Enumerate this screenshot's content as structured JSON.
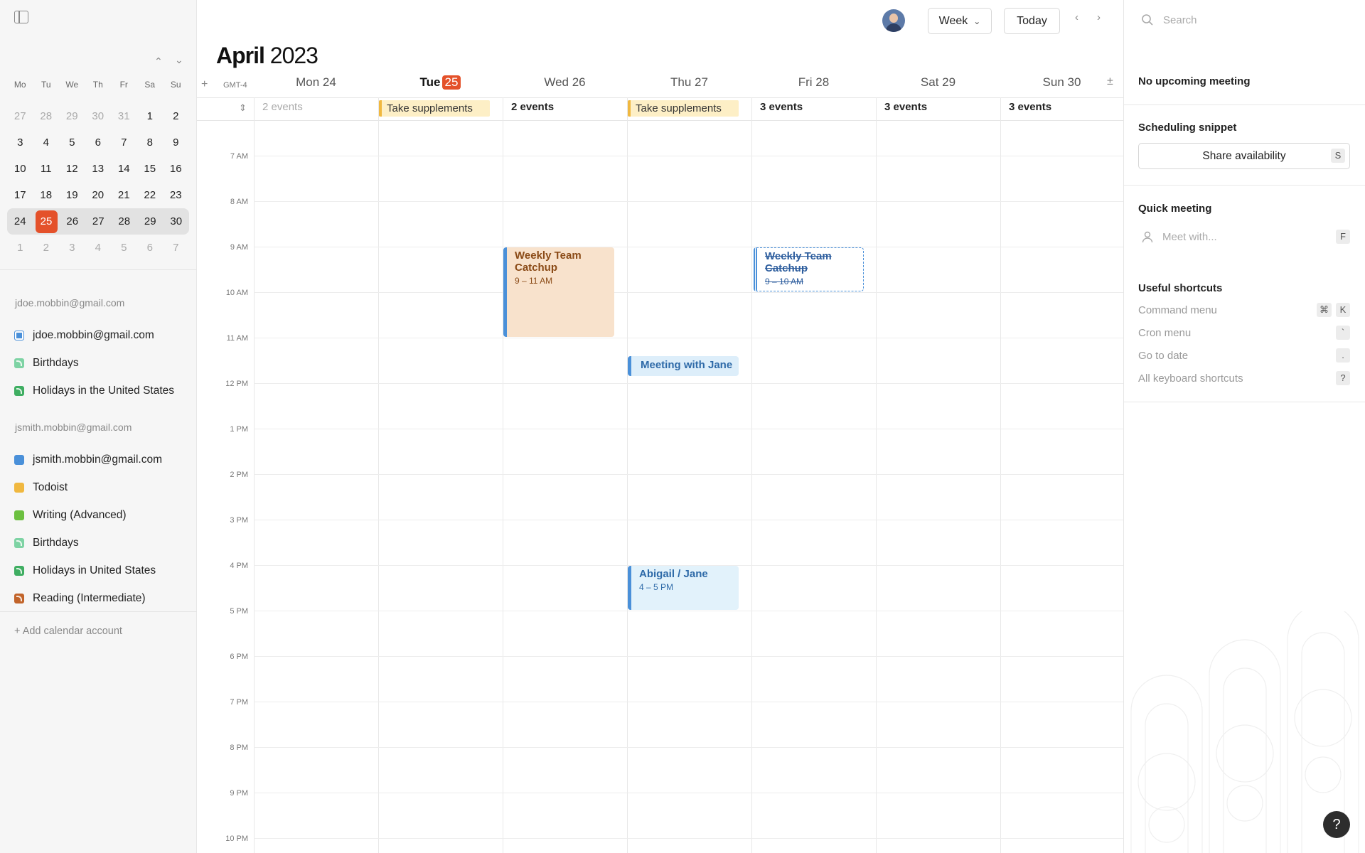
{
  "sidebar": {
    "mini_calendar": {
      "weekday_headers": [
        "Mo",
        "Tu",
        "We",
        "Th",
        "Fr",
        "Sa",
        "Su"
      ],
      "weeks": [
        [
          "27",
          "28",
          "29",
          "30",
          "31",
          "1",
          "2"
        ],
        [
          "3",
          "4",
          "5",
          "6",
          "7",
          "8",
          "9"
        ],
        [
          "10",
          "11",
          "12",
          "13",
          "14",
          "15",
          "16"
        ],
        [
          "17",
          "18",
          "19",
          "20",
          "21",
          "22",
          "23"
        ],
        [
          "24",
          "25",
          "26",
          "27",
          "28",
          "29",
          "30"
        ],
        [
          "1",
          "2",
          "3",
          "4",
          "5",
          "6",
          "7"
        ]
      ],
      "today": "25"
    },
    "accounts": [
      {
        "email": "jdoe.mobbin@gmail.com",
        "calendars": [
          {
            "name": "jdoe.mobbin@gmail.com",
            "color": "#4a90d9",
            "type": "checked"
          },
          {
            "name": "Birthdays",
            "color": "#7ed3a4",
            "type": "rss"
          },
          {
            "name": "Holidays in the United States",
            "color": "#3fae62",
            "type": "rss"
          }
        ]
      },
      {
        "email": "jsmith.mobbin@gmail.com",
        "calendars": [
          {
            "name": "jsmith.mobbin@gmail.com",
            "color": "#4a90d9",
            "type": "plain"
          },
          {
            "name": "Todoist",
            "color": "#f0b840",
            "type": "plain"
          },
          {
            "name": "Writing (Advanced)",
            "color": "#6cc040",
            "type": "plain"
          },
          {
            "name": "Birthdays",
            "color": "#7ed3a4",
            "type": "rss"
          },
          {
            "name": "Holidays in United States",
            "color": "#3fae62",
            "type": "rss"
          },
          {
            "name": "Reading (Intermediate)",
            "color": "#c2642a",
            "type": "rss"
          }
        ]
      }
    ],
    "add_account_label": "+ Add calendar account"
  },
  "toolbar": {
    "view_label": "Week",
    "today_label": "Today"
  },
  "calendar": {
    "month": "April",
    "year": "2023",
    "timezone": "GMT-4",
    "days": [
      {
        "label": "Mon 24",
        "allday": "2 events",
        "allday_dim": true
      },
      {
        "label": "Tue",
        "badge": "25",
        "today": true,
        "allday_event": "Take supplements"
      },
      {
        "label": "Wed 26",
        "allday": "2 events"
      },
      {
        "label": "Thu 27",
        "allday_event": "Take supplements"
      },
      {
        "label": "Fri 28",
        "allday": "3 events"
      },
      {
        "label": "Sat 29",
        "allday": "3 events"
      },
      {
        "label": "Sun 30",
        "allday": "3 events"
      }
    ],
    "hours": [
      "7 AM",
      "8 AM",
      "9 AM",
      "10 AM",
      "11 AM",
      "12 PM",
      "1 PM",
      "2 PM",
      "3 PM",
      "4 PM",
      "5 PM",
      "6 PM",
      "7 PM",
      "8 PM",
      "9 PM",
      "10 PM"
    ],
    "events": [
      {
        "title": "Weekly Team Catchup",
        "time": "9 – 11 AM",
        "day": 2
      },
      {
        "title": "Weekly Team Catchup",
        "time": "9 – 10 AM",
        "day": 4,
        "cancelled": true
      },
      {
        "title": "Meeting with Jane",
        "day": 3
      },
      {
        "title": "Abigail / Jane",
        "time": "4 – 5 PM",
        "day": 3
      }
    ]
  },
  "right_panel": {
    "search_placeholder": "Search",
    "upcoming": "No upcoming meeting",
    "scheduling_title": "Scheduling snippet",
    "share_label": "Share availability",
    "share_key": "S",
    "quick_title": "Quick meeting",
    "meet_placeholder": "Meet with...",
    "meet_key": "F",
    "shortcuts_title": "Useful shortcuts",
    "shortcuts": [
      {
        "label": "Command menu",
        "keys": [
          "⌘",
          "K"
        ]
      },
      {
        "label": "Cron menu",
        "keys": [
          "`"
        ]
      },
      {
        "label": "Go to date",
        "keys": [
          "."
        ]
      },
      {
        "label": "All keyboard shortcuts",
        "keys": [
          "?"
        ]
      }
    ],
    "help_label": "?"
  }
}
